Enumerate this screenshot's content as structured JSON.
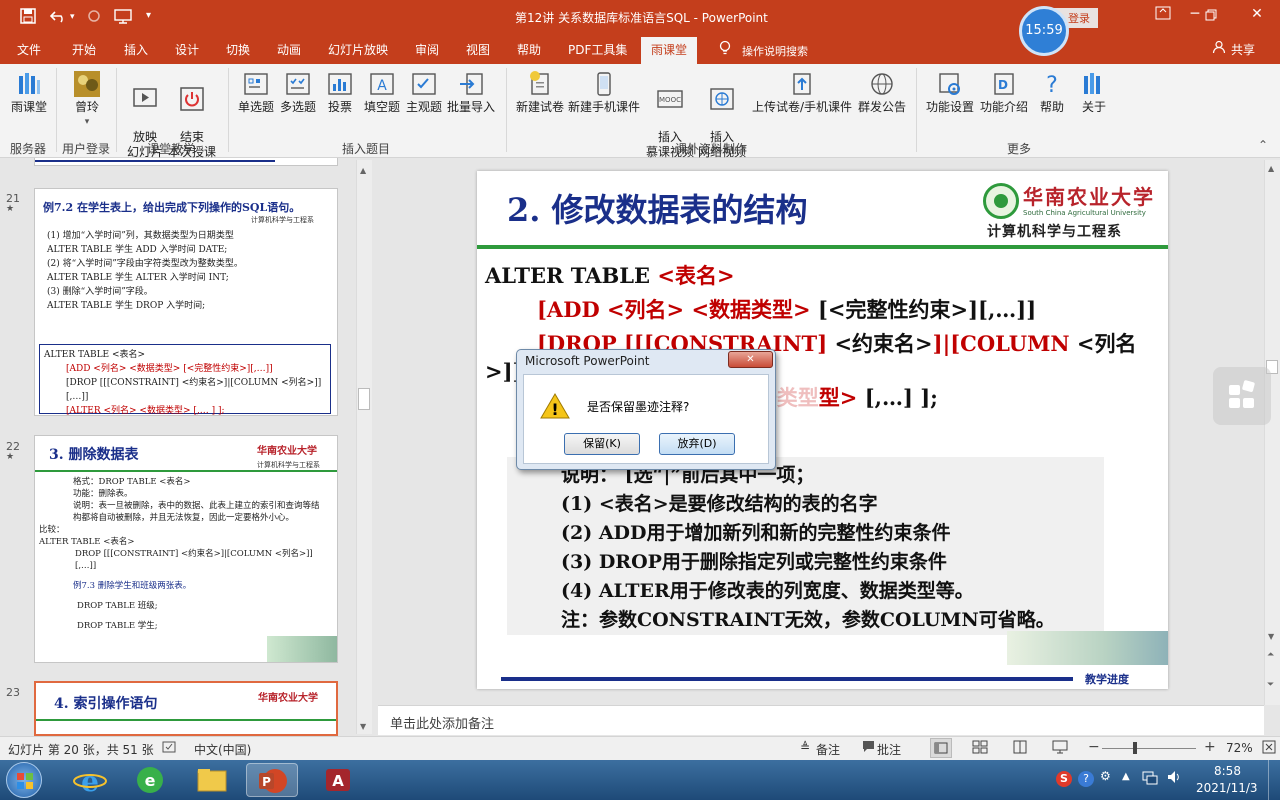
{
  "window": {
    "title": "第12讲 关系数据库标准语言SQL  -  PowerPoint",
    "signin": "登录",
    "clock_bubble": "15:59"
  },
  "tabs": [
    "文件",
    "开始",
    "插入",
    "设计",
    "切换",
    "动画",
    "幻灯片放映",
    "审阅",
    "视图",
    "帮助",
    "PDF工具集",
    "雨课堂"
  ],
  "tell_me": "操作说明搜索",
  "share": "共享",
  "ribbon": {
    "buttons": [
      {
        "label": "雨课堂"
      },
      {
        "label": "曾玲"
      },
      {
        "label": "放映\n幻灯片"
      },
      {
        "label": "结束\n本次授课"
      },
      {
        "label": "单选题"
      },
      {
        "label": "多选题"
      },
      {
        "label": "投票"
      },
      {
        "label": "填空题"
      },
      {
        "label": "主观题"
      },
      {
        "label": "批量导入"
      },
      {
        "label": "新建试卷"
      },
      {
        "label": "新建手机课件"
      },
      {
        "label": "插入\n慕课视频"
      },
      {
        "label": "插入\n网络视频"
      },
      {
        "label": "上传试卷/手机课件"
      },
      {
        "label": "群发公告"
      },
      {
        "label": "功能设置"
      },
      {
        "label": "功能介绍"
      },
      {
        "label": "帮助"
      },
      {
        "label": "关于"
      }
    ],
    "groups": [
      "服务器",
      "用户登录",
      "课堂教学",
      "插入题目",
      "课外资料制作",
      "更多"
    ]
  },
  "thumbs": {
    "s21": {
      "num": "21",
      "title": "例7.2 在学生表上，给出完成下列操作的SQL语句。",
      "lines": [
        "(1) 增加“入学时间”列，其数据类型为日期类型",
        "ALTER TABLE  学生 ADD 入学时间  DATE;",
        "(2) 将“入学时间”字段由字符类型改为整数类型。",
        "ALTER TABLE  学生 ALTER 入学时间 INT;",
        "(3) 删除“入学时间”字段。",
        "ALTER TABLE  学生 DROP 入学时间;"
      ],
      "box": [
        "ALTER TABLE <表名>",
        "[ADD <列名> <数据类型> [<完整性约束>][,…]]",
        "[DROP [[[CONSTRAINT] <约束名>]|[COLUMN <列名>]][,…]]",
        "[ALTER <列名> <数据类型> [,… ] ];"
      ]
    },
    "s22": {
      "num": "22",
      "title": "3. 删除数据表",
      "lines": [
        "格式：DROP  TABLE <表名>",
        "功能：删除表。",
        "说明：表一旦被删除，表中的数据、此表上建立的索引和查询等结构都将自动被删除，并且无法恢复，因此一定要格外小心。",
        "比较：",
        "ALTER  TABLE  <表名>",
        "DROP [[[CONSTRAINT] <约束名>]|[COLUMN <列名>]][,…]]",
        "例7.3  删除学生和班级两张表。",
        "DROP TABLE  班级;",
        "DROP TABLE  学生;"
      ]
    },
    "s23": {
      "num": "23",
      "title": "4. 索引操作语句"
    },
    "university": "华南农业大学",
    "dept": "计算机科学与工程系"
  },
  "slide": {
    "title": "2. 修改数据表的结构",
    "university": "华南农业大学",
    "university_en": "South China Agricultural University",
    "dept": "计算机科学与工程系",
    "syntax": {
      "l1a": "ALTER  TABLE  ",
      "l1b": "<表名>",
      "l2a": "[ADD  <列名> <数据类型> ",
      "l2b": "[<完整性约束>][,…]]",
      "l3a": "[DROP  [[[CONSTRAINT]  ",
      "l3b": "<约束名>",
      "l3c": "]|[COLUMN  ",
      "l3d": "<列名",
      "l4": ">]][,…]]",
      "l5a": "[ALTER <列名> <数据类型",
      "l5b": "型> ",
      "l5c": "[,…]  ];"
    },
    "notes": [
      "说明：  [选“|”前后其中一项；",
      "(1) <表名>是要修改结构的表的名字",
      "(2) ADD用于增加新列和新的完整性约束条件",
      "(3) DROP用于删除指定列或完整性约束条件",
      "(4) ALTER用于修改表的列宽度、数据类型等。",
      "注：参数CONSTRAINT无效，参数COLUMN可省略。"
    ],
    "footer": "教学进度"
  },
  "dialog": {
    "title": "Microsoft PowerPoint",
    "message": "是否保留墨迹注释?",
    "keep": "保留(K)",
    "discard": "放弃(D)"
  },
  "notes_placeholder": "单击此处添加备注",
  "status": {
    "slide_info": "幻灯片 第 20 张，共 51 张",
    "language": "中文(中国)",
    "notes": "备注",
    "comments": "批注",
    "zoom": "72%"
  },
  "taskbar": {
    "time": "8:58",
    "date": "2021/11/3"
  },
  "colors": {
    "accent": "#c43e1c",
    "title_blue": "#1a2f8a",
    "syntax_red": "#c00000",
    "green_rule": "#2e9a3c"
  }
}
